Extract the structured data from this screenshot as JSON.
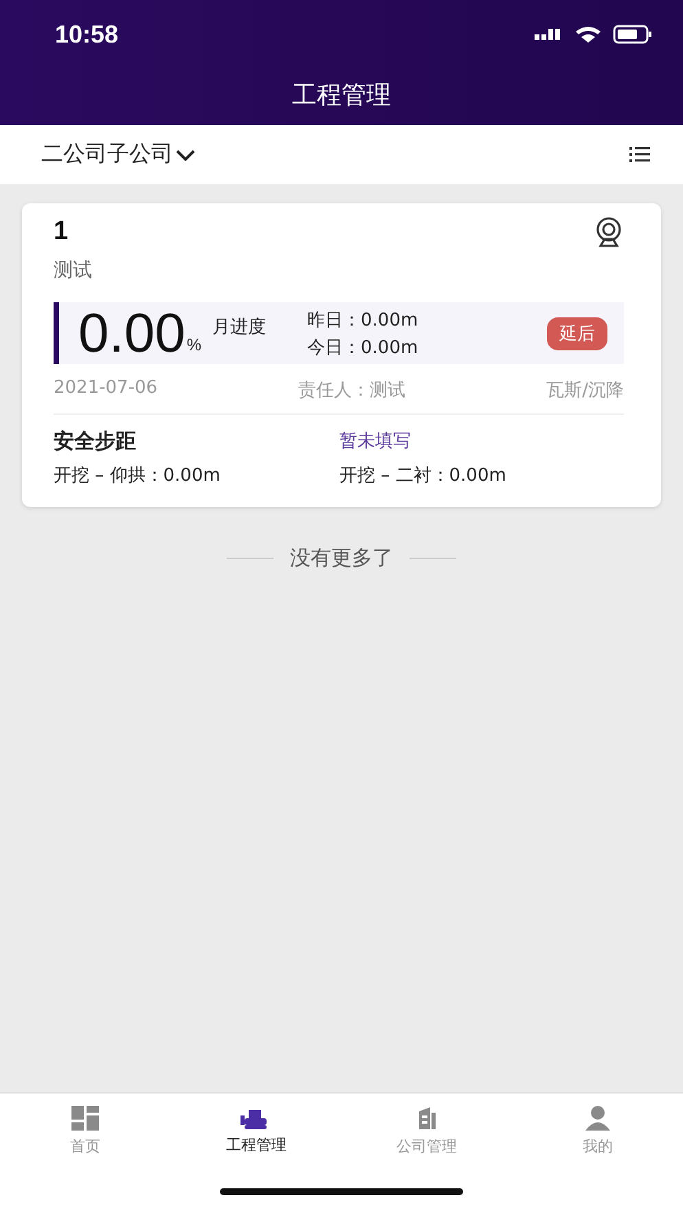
{
  "status_bar": {
    "time": "10:58"
  },
  "header": {
    "title": "工程管理"
  },
  "filter": {
    "company": "二公司子公司"
  },
  "projects": [
    {
      "number": "1",
      "name": "测试",
      "progress": "0.00",
      "unit": "%",
      "progress_label": "月进度",
      "yesterday": "昨日：0.00m",
      "today": "今日：0.00m",
      "status": "延后",
      "date": "2021-07-06",
      "manager": "责任人：测试",
      "type": "瓦斯/沉降",
      "safety_title": "安全步距",
      "safety_status": "暂未填写",
      "distances": [
        "开挖 – 仰拱：0.00m",
        "开挖 – 二衬：0.00m"
      ]
    }
  ],
  "end_note": "没有更多了",
  "tabs": [
    {
      "kind": "home",
      "label": "首页",
      "selected": false
    },
    {
      "kind": "project",
      "label": "工程管理",
      "selected": true
    },
    {
      "kind": "company",
      "label": "公司管理",
      "selected": false
    },
    {
      "kind": "me",
      "label": "我的",
      "selected": false
    }
  ]
}
